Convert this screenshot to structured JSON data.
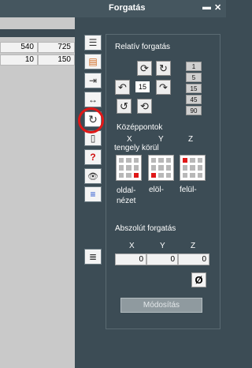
{
  "window": {
    "title": "Forgatás",
    "minimize_glyph": "▬",
    "close_glyph": "✕"
  },
  "sheet": {
    "rows": [
      [
        "540",
        "725"
      ],
      [
        "10",
        "150"
      ]
    ]
  },
  "toolbar": {
    "tools": [
      {
        "name": "align-left-icon",
        "glyph": "☰"
      },
      {
        "name": "page-icon",
        "glyph": "▤"
      },
      {
        "name": "move-right-icon",
        "glyph": "⇥"
      },
      {
        "name": "resize-icon",
        "glyph": "↔"
      },
      {
        "name": "rotate-icon",
        "glyph": "↻"
      },
      {
        "name": "document-icon",
        "glyph": "▯"
      },
      {
        "name": "help-flip-icon",
        "glyph": "?"
      },
      {
        "name": "eye-icon",
        "glyph": "👁"
      },
      {
        "name": "color-layers-icon",
        "glyph": "≡"
      },
      {
        "name": "list-icon",
        "glyph": "≣"
      }
    ]
  },
  "panel": {
    "relative_title": "Relatív forgatás",
    "rotation_value": "15",
    "steps": [
      "1",
      "5",
      "15",
      "45",
      "90"
    ],
    "centers_title": "Középpontok",
    "axis_x": "X",
    "axis_y": "Y",
    "axis_z": "Z",
    "around_axis": "tengely körül",
    "view_side": "oldal-\nnézet",
    "view_front": "elöl-",
    "view_top": "felül-",
    "absolute_title": "Abszolút forgatás",
    "abs_x": "0",
    "abs_y": "0",
    "abs_z": "0",
    "reset_glyph": "Ø",
    "apply_label": "Módosítás"
  }
}
